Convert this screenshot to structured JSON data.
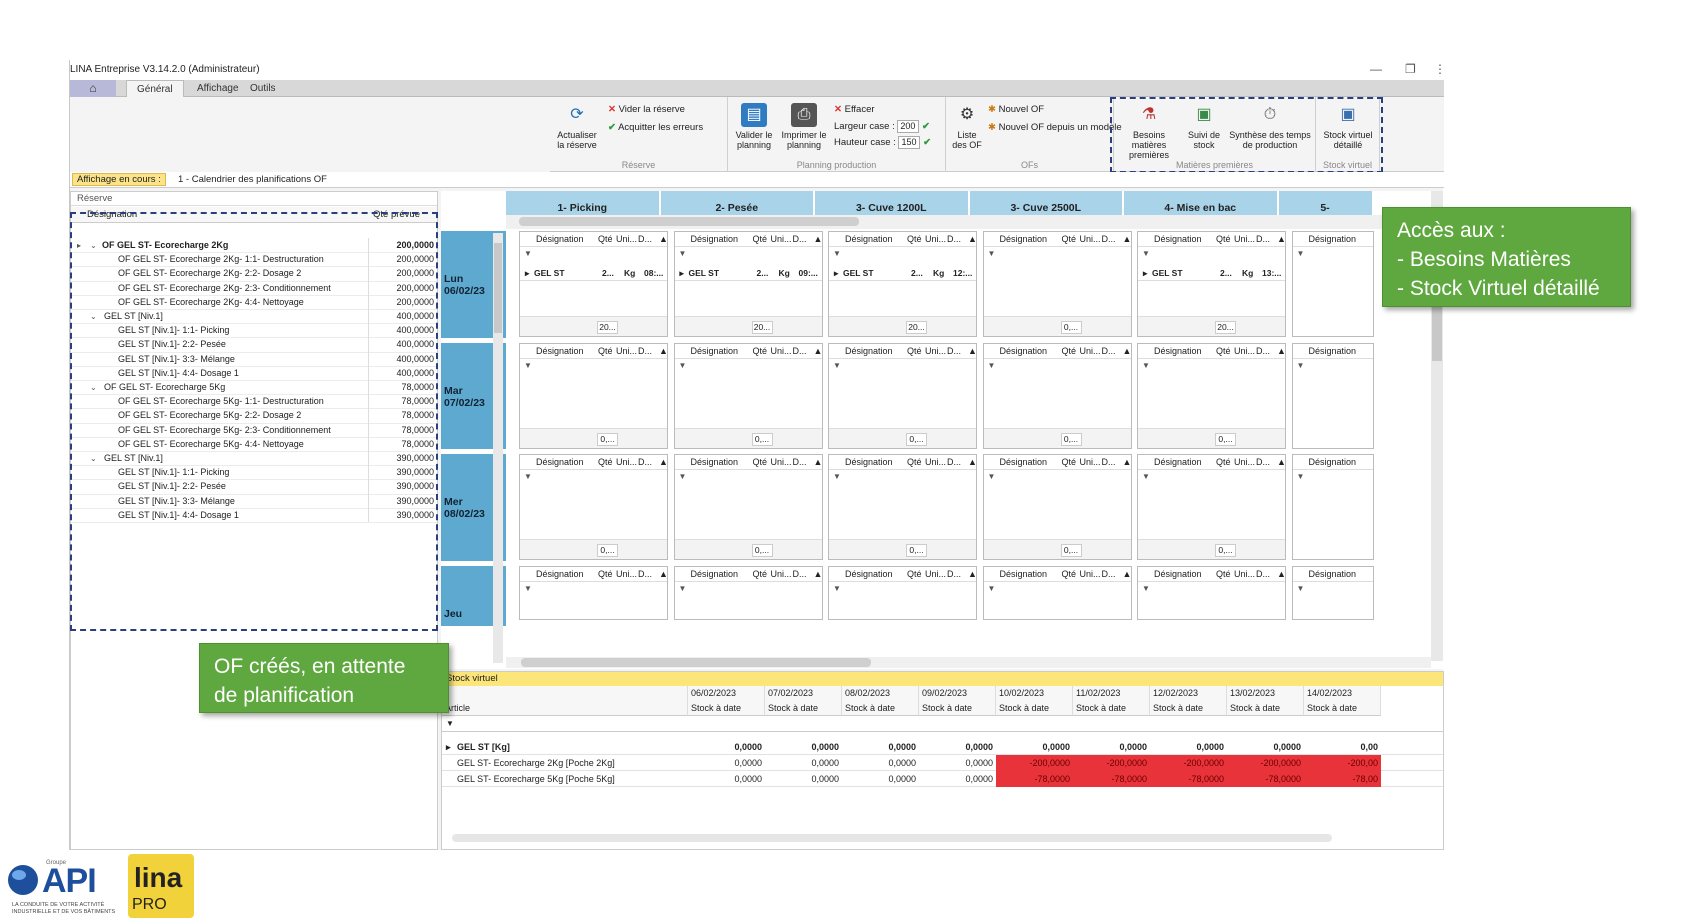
{
  "window": {
    "title": "LINA Entreprise  V3.14.2.0  (Administrateur)",
    "minimize_glyph": "—",
    "restore_glyph": "❐",
    "more_glyph": "⋮"
  },
  "tabs": [
    "Général",
    "Affichage",
    "Outils"
  ],
  "ribbon": {
    "reserve": {
      "group_label": "Réserve",
      "refresh_label_1": "Actualiser",
      "refresh_label_2": "la réserve",
      "clear_label": "Vider la réserve",
      "ack_label": "Acquitter les erreurs"
    },
    "planning": {
      "group_label": "Planning production",
      "validate_1": "Valider le",
      "validate_2": "planning",
      "print_1": "Imprimer le",
      "print_2": "planning",
      "erase_label": "Effacer",
      "width_label": "Largeur case :",
      "width_value": "200",
      "height_label": "Hauteur case :",
      "height_value": "150"
    },
    "ofs": {
      "group_label": "OFs",
      "list_1": "Liste",
      "list_2": "des OF",
      "new_of": "Nouvel OF",
      "new_of_model": "Nouvel OF depuis un modèle"
    },
    "matieres": {
      "group_label": "Matières premières",
      "besoins_1": "Besoins matières",
      "besoins_2": "premières",
      "suivi_1": "Suivi de",
      "suivi_2": "stock",
      "synthese_1": "Synthèse des temps",
      "synthese_2": "de production"
    },
    "stock_virtuel": {
      "group_label": "Stock virtuel",
      "btn_1": "Stock virtuel",
      "btn_2": "détaillé"
    }
  },
  "view_bar": {
    "badge": "Affichage en cours :",
    "value": "1 - Calendrier des planifications OF"
  },
  "reserve_panel": {
    "title": "Réserve",
    "col_designation": "Désignation",
    "col_qty": "Qté prévue",
    "rows": [
      {
        "label": "OF GEL ST- Ecorecharge 2Kg",
        "qty": "200,0000",
        "level": 0,
        "bold": true
      },
      {
        "label": "OF GEL ST- Ecorecharge 2Kg- 1:1- Destructuration",
        "qty": "200,0000",
        "level": 2,
        "bold": false
      },
      {
        "label": "OF GEL ST- Ecorecharge 2Kg- 2:2- Dosage 2",
        "qty": "200,0000",
        "level": 2,
        "bold": false
      },
      {
        "label": "OF GEL ST- Ecorecharge 2Kg- 2:3- Conditionnement",
        "qty": "200,0000",
        "level": 2,
        "bold": false
      },
      {
        "label": "OF GEL ST- Ecorecharge 2Kg- 4:4- Nettoyage",
        "qty": "200,0000",
        "level": 2,
        "bold": false
      },
      {
        "label": "GEL ST [Niv.1]",
        "qty": "400,0000",
        "level": 1,
        "bold": false
      },
      {
        "label": "GEL ST [Niv.1]- 1:1- Picking",
        "qty": "400,0000",
        "level": 2,
        "bold": false
      },
      {
        "label": "GEL ST [Niv.1]- 2:2- Pesée",
        "qty": "400,0000",
        "level": 2,
        "bold": false
      },
      {
        "label": "GEL ST [Niv.1]- 3:3- Mélange",
        "qty": "400,0000",
        "level": 2,
        "bold": false
      },
      {
        "label": "GEL ST [Niv.1]- 4:4- Dosage 1",
        "qty": "400,0000",
        "level": 2,
        "bold": false
      },
      {
        "label": "OF GEL ST- Ecorecharge 5Kg",
        "qty": "78,0000",
        "level": 1,
        "bold": false
      },
      {
        "label": "OF GEL ST- Ecorecharge 5Kg- 1:1- Destructuration",
        "qty": "78,0000",
        "level": 2,
        "bold": false
      },
      {
        "label": "OF GEL ST- Ecorecharge 5Kg- 2:2- Dosage 2",
        "qty": "78,0000",
        "level": 2,
        "bold": false
      },
      {
        "label": "OF GEL ST- Ecorecharge 5Kg- 2:3- Conditionnement",
        "qty": "78,0000",
        "level": 2,
        "bold": false
      },
      {
        "label": "OF GEL ST- Ecorecharge 5Kg- 4:4- Nettoyage",
        "qty": "78,0000",
        "level": 2,
        "bold": false
      },
      {
        "label": "GEL ST [Niv.1]",
        "qty": "390,0000",
        "level": 1,
        "bold": false
      },
      {
        "label": "GEL ST [Niv.1]- 1:1- Picking",
        "qty": "390,0000",
        "level": 2,
        "bold": false
      },
      {
        "label": "GEL ST [Niv.1]- 2:2- Pesée",
        "qty": "390,0000",
        "level": 2,
        "bold": false
      },
      {
        "label": "GEL ST [Niv.1]- 3:3- Mélange",
        "qty": "390,0000",
        "level": 2,
        "bold": false
      },
      {
        "label": "GEL ST [Niv.1]- 4:4- Dosage 1",
        "qty": "390,0000",
        "level": 2,
        "bold": false
      }
    ]
  },
  "planning": {
    "posts": [
      "1- Picking",
      "2- Pesée",
      "3- Cuve 1200L",
      "3- Cuve 2500L",
      "4- Mise en bac",
      "5-"
    ],
    "cell_cols": [
      "Désignation",
      "Qté",
      "Uni...",
      "D...",
      "▲"
    ],
    "days": [
      {
        "name": "Lun",
        "date": "06/02/23"
      },
      {
        "name": "Mar",
        "date": "07/02/23"
      },
      {
        "name": "Mer",
        "date": "08/02/23"
      },
      {
        "name": "Jeu",
        "date": ""
      }
    ],
    "row1_entries": [
      {
        "designation": "GEL ST",
        "qty": "2...",
        "unit": "Kg",
        "d": "08:...",
        "total": "20..."
      },
      {
        "designation": "GEL ST",
        "qty": "2...",
        "unit": "Kg",
        "d": "09:...",
        "total": "20..."
      },
      {
        "designation": "GEL ST",
        "qty": "2...",
        "unit": "Kg",
        "d": "12:...",
        "total": "20..."
      },
      {
        "designation": "",
        "qty": "",
        "unit": "",
        "d": "",
        "total": "0,..."
      },
      {
        "designation": "GEL ST",
        "qty": "2...",
        "unit": "Kg",
        "d": "13:...",
        "total": "20..."
      }
    ],
    "empty_total": "0,..."
  },
  "stock_virtuel": {
    "title": "Stock virtuel",
    "col_article": "Article",
    "sub_label": "Stock à date",
    "dates": [
      "06/02/2023",
      "07/02/2023",
      "08/02/2023",
      "09/02/2023",
      "10/02/2023",
      "11/02/2023",
      "12/02/2023",
      "13/02/2023",
      "14/02/2023"
    ],
    "rows": [
      {
        "article": "GEL ST [Kg]",
        "bold": true,
        "values": [
          "0,0000",
          "0,0000",
          "0,0000",
          "0,0000",
          "0,0000",
          "0,0000",
          "0,0000",
          "0,0000",
          "0,00"
        ]
      },
      {
        "article": "GEL ST- Ecorecharge 2Kg [Poche 2Kg]",
        "bold": false,
        "values": [
          "0,0000",
          "0,0000",
          "0,0000",
          "0,0000",
          "-200,0000",
          "-200,0000",
          "-200,0000",
          "-200,0000",
          "-200,00"
        ]
      },
      {
        "article": "GEL ST- Ecorecharge 5Kg [Poche 5Kg]",
        "bold": false,
        "values": [
          "0,0000",
          "0,0000",
          "0,0000",
          "0,0000",
          "-78,0000",
          "-78,0000",
          "-78,0000",
          "-78,0000",
          "-78,00"
        ]
      }
    ]
  },
  "callouts": {
    "right_line1": "Accès aux :",
    "right_line2": "- Besoins Matières",
    "right_line3": "- Stock Virtuel détaillé",
    "left_line1": "OF créés, en attente",
    "left_line2": "de planification"
  },
  "logos": {
    "api_small": "Groupe",
    "api_text": "API",
    "api_tagline1": "LA CONDUITE DE VOTRE ACTIVITÉ",
    "api_tagline2": "INDUSTRIELLE ET DE VOS BÂTIMENTS",
    "lina_text": "lina",
    "pro_text": "PRO"
  },
  "colors": {
    "accent_day": "#5ea9cf",
    "post_header": "#a9d3e9",
    "negative": "#e8333a",
    "callout": "#5fa840",
    "dash": "#2b3f7e"
  }
}
